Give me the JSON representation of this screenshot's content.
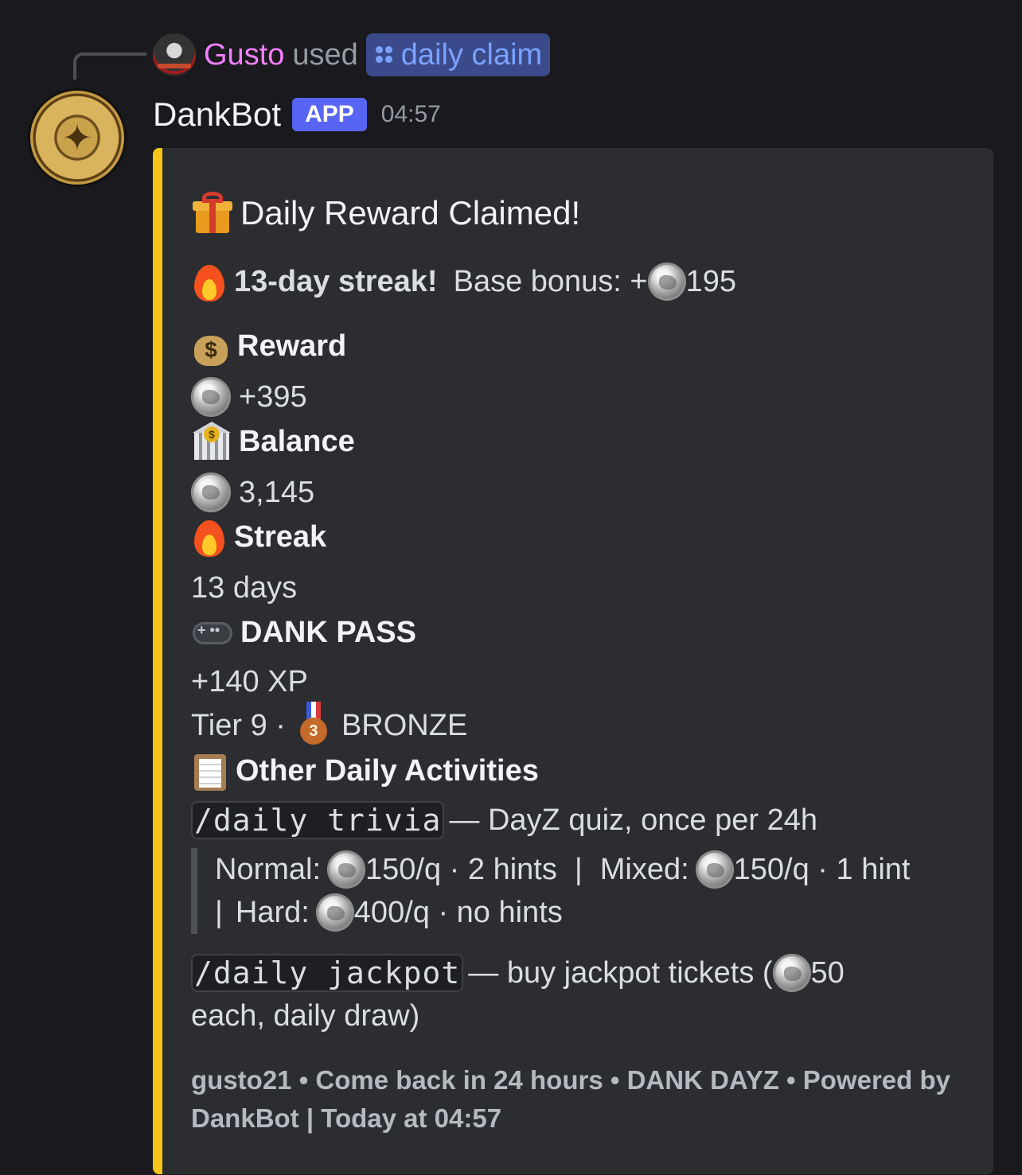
{
  "reply": {
    "username": "Gusto",
    "used_text": "used",
    "command": "daily claim"
  },
  "message": {
    "bot_name": "DankBot",
    "badge": "APP",
    "time": "04:57"
  },
  "embed": {
    "accent_color": "#f5c518",
    "title": "Daily Reward Claimed!",
    "streak_bold": "13-day streak!",
    "streak_bonus_label": "Base bonus: +",
    "streak_bonus_value": "195",
    "fields": {
      "reward_name": "Reward",
      "reward_value": "+395",
      "balance_name": "Balance",
      "balance_value": "3,145",
      "streak_name": "Streak",
      "streak_value": "13 days",
      "pass_name": "DANK PASS",
      "pass_xp": "+140 XP",
      "pass_tier": "Tier 9 ·",
      "pass_rank": "BRONZE",
      "activities_name": "Other Daily Activities"
    },
    "trivia": {
      "command": "/daily trivia",
      "desc": "— DayZ quiz, once per 24h",
      "normal_label": "Normal:",
      "normal_value": "150/q · 2 hints",
      "sep1": "|",
      "mixed_label": "Mixed:",
      "mixed_value": "150/q · 1 hint",
      "sep2": "|",
      "hard_label": "Hard:",
      "hard_value": "400/q · no hints"
    },
    "jackpot": {
      "command": "/daily jackpot",
      "desc_pre": "— buy jackpot tickets (",
      "price": "50",
      "desc_post": "each, daily draw)"
    },
    "footer": {
      "line1": "gusto21 • Come back in 24 hours • DANK DAYZ • Powered by",
      "line2": "DankBot | Today at 04:57"
    }
  },
  "colors": {
    "background": "#1a1a1e",
    "embed_bg": "#2b2d31",
    "username_pink": "#f47fff",
    "badge_blue": "#5865f2",
    "command_pill": "#3b4a8a"
  },
  "icons": [
    "gift-icon",
    "fire-icon",
    "money-bag-icon",
    "bank-icon",
    "game-controller-icon",
    "bronze-medal-icon",
    "clipboard-icon",
    "silver-coin-icon",
    "command-icon"
  ]
}
